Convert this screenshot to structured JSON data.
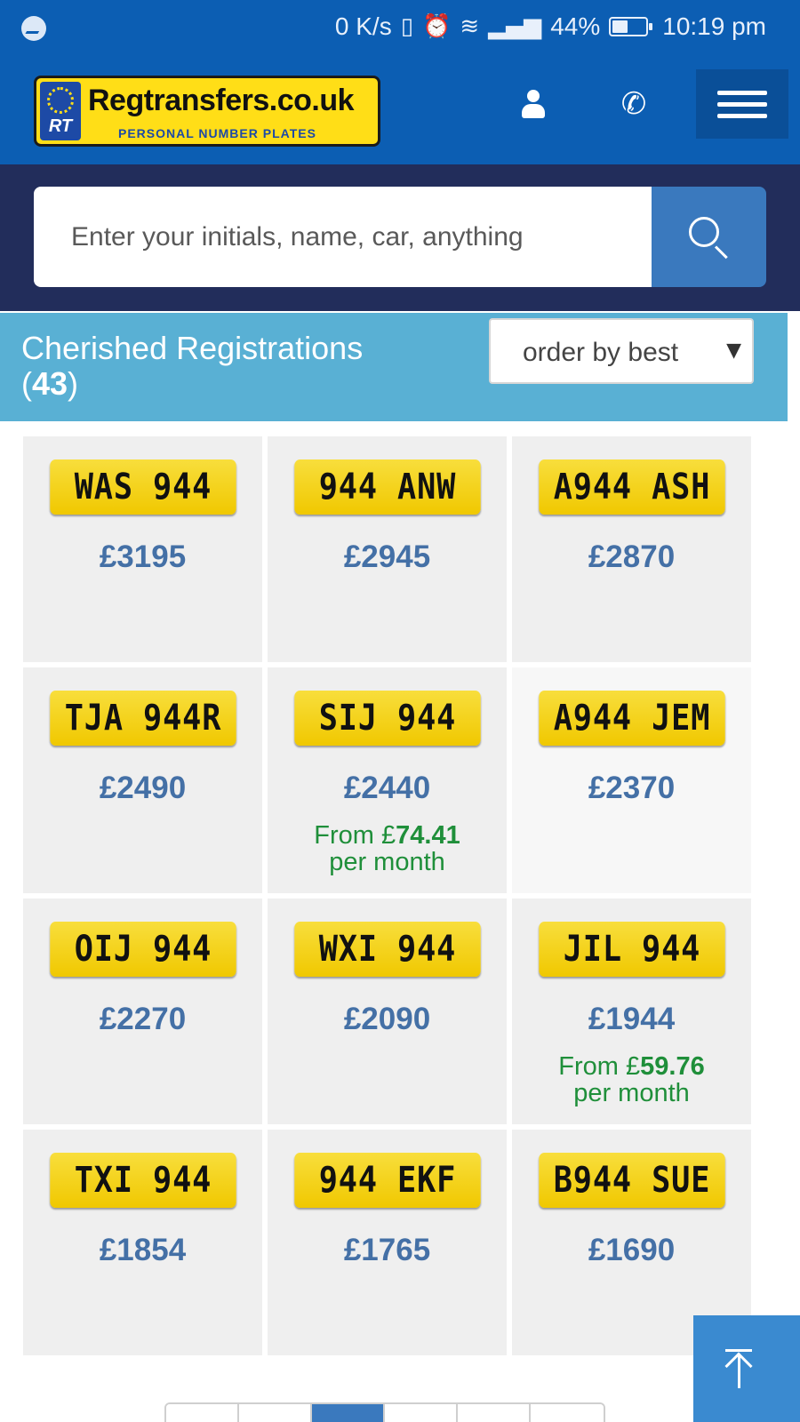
{
  "status_bar": {
    "net_speed": "0 K/s",
    "battery": "44%",
    "time": "10:19 pm"
  },
  "header": {
    "logo_text": "Regtransfers.co.uk",
    "logo_tagline": "PERSONAL NUMBER PLATES",
    "logo_badge": "RT"
  },
  "search": {
    "placeholder": "Enter your initials, name, car, anything"
  },
  "results": {
    "title": "Cherished Registrations",
    "count": "43",
    "sort_value": "order by best"
  },
  "plates": [
    {
      "reg": "WAS 944",
      "price": "£3195"
    },
    {
      "reg": "944 ANW",
      "price": "£2945"
    },
    {
      "reg": "A944 ASH",
      "price": "£2870"
    },
    {
      "reg": "TJA 944R",
      "price": "£2490"
    },
    {
      "reg": "SIJ 944",
      "price": "£2440",
      "finance_prefix": "From £",
      "finance_amount": "74.41",
      "finance_suffix": "per month"
    },
    {
      "reg": "A944 JEM",
      "price": "£2370"
    },
    {
      "reg": "OIJ 944",
      "price": "£2270"
    },
    {
      "reg": "WXI 944",
      "price": "£2090"
    },
    {
      "reg": "JIL 944",
      "price": "£1944",
      "finance_prefix": "From £",
      "finance_amount": "59.76",
      "finance_suffix": "per month"
    },
    {
      "reg": "TXI 944",
      "price": "£1854"
    },
    {
      "reg": "944 EKF",
      "price": "£1765"
    },
    {
      "reg": "B944 SUE",
      "price": "£1690"
    }
  ],
  "colors": {
    "header_blue": "#0c5eb3",
    "search_band": "#222d5b",
    "results_bar": "#59b0d4",
    "price_blue": "#4470a6",
    "finance_green": "#1f8f3a",
    "plate_yellow": "#f0c800"
  }
}
